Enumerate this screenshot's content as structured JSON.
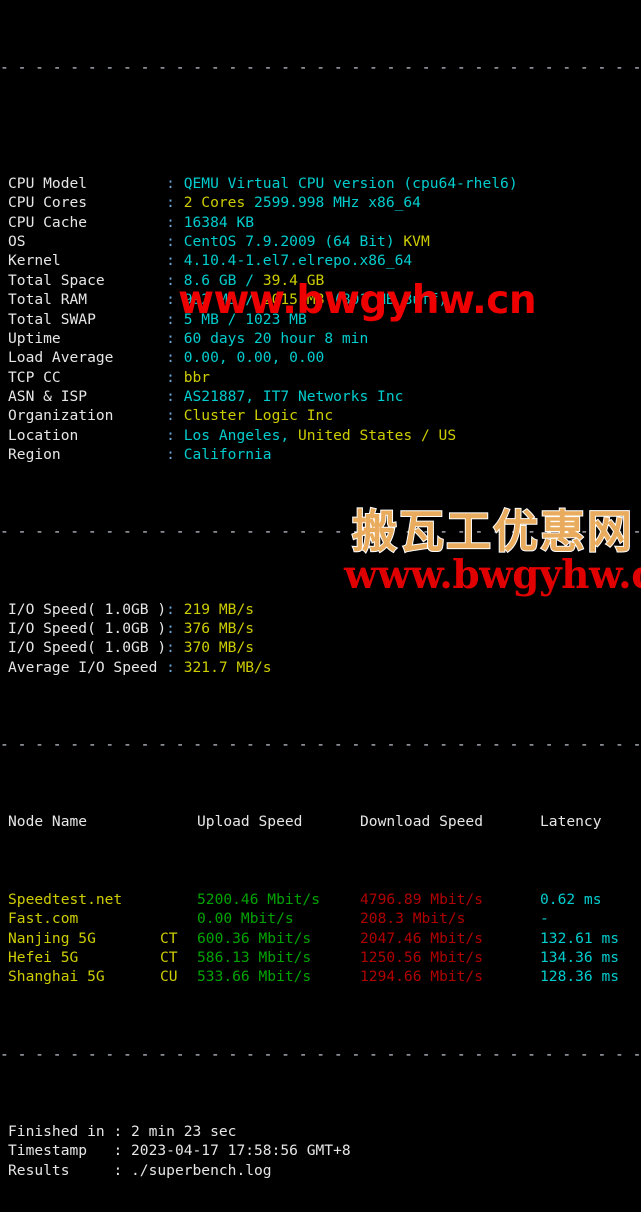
{
  "terminal": {
    "separator_top": "- - - - - - - - - - - - - - - - - - - - - - - - - - - - - - - - - - - - - - - - - -",
    "separator_mid": "- - - - - - - - - - - - - - - - - - - - - - - - - - - - - - - - - - - - - - - - - -",
    "separator_table": "- - - - - - - - - - - - - - - - - - - - - - - - - - - - - - - - - - - - - - - - - -",
    "separator_bottom": "- - - - - - - - - - - - - - - - - - - - - - - - - - - - - - - - - - - - - - - - - -",
    "colon": ":"
  },
  "sysinfo": [
    {
      "label": "CPU Model",
      "value_cyan": "QEMU Virtual CPU version (cpu64-rhel6)",
      "value_yellow": "",
      "value_tail": ""
    },
    {
      "label": "CPU Cores",
      "value_cyan": "",
      "value_yellow": "2 Cores",
      "value_tail": " 2599.998 MHz x86_64"
    },
    {
      "label": "CPU Cache",
      "value_cyan": "16384 KB",
      "value_yellow": "",
      "value_tail": ""
    },
    {
      "label": "OS",
      "value_cyan": "CentOS 7.9.2009 (64 Bit) ",
      "value_yellow": "KVM",
      "value_tail": ""
    },
    {
      "label": "Kernel",
      "value_cyan": "4.10.4-1.el7.elrepo.x86_64",
      "value_yellow": "",
      "value_tail": ""
    },
    {
      "label": "Total Space",
      "value_cyan": "8.6 GB / ",
      "value_yellow": "39.4 GB",
      "value_tail": ""
    },
    {
      "label": "Total RAM",
      "value_cyan": "992 MB / ",
      "value_yellow": "2015 MB",
      "value_tail": " (801 MB Buff)"
    },
    {
      "label": "Total SWAP",
      "value_cyan": "5 MB / 1023 MB",
      "value_yellow": "",
      "value_tail": ""
    },
    {
      "label": "Uptime",
      "value_cyan": "60 days 20 hour 8 min",
      "value_yellow": "",
      "value_tail": ""
    },
    {
      "label": "Load Average",
      "value_cyan": "0.00, 0.00, 0.00",
      "value_yellow": "",
      "value_tail": ""
    },
    {
      "label": "TCP CC",
      "value_cyan": "",
      "value_yellow": "bbr",
      "value_tail": ""
    },
    {
      "label": "ASN & ISP",
      "value_cyan": "AS21887, IT7 Networks Inc",
      "value_yellow": "",
      "value_tail": ""
    },
    {
      "label": "Organization",
      "value_cyan": "",
      "value_yellow": "Cluster Logic Inc",
      "value_tail": ""
    },
    {
      "label": "Location",
      "value_cyan": "Los Angeles, ",
      "value_yellow": "United States / US",
      "value_tail": ""
    },
    {
      "label": "Region",
      "value_cyan": "California",
      "value_yellow": "",
      "value_tail": ""
    }
  ],
  "iospeed": [
    {
      "label": "I/O Speed( 1.0GB )",
      "value": "219 MB/s"
    },
    {
      "label": "I/O Speed( 1.0GB )",
      "value": "376 MB/s"
    },
    {
      "label": "I/O Speed( 1.0GB )",
      "value": "370 MB/s"
    },
    {
      "label": "Average I/O Speed",
      "value": "321.7 MB/s"
    }
  ],
  "speedtest": {
    "headers": {
      "node": "Node Name",
      "upload": "Upload Speed",
      "download": "Download Speed",
      "latency": "Latency"
    },
    "rows": [
      {
        "node": "Speedtest.net",
        "isp": "",
        "upload": "5200.46 Mbit/s",
        "download": "4796.89 Mbit/s",
        "latency": "0.62 ms"
      },
      {
        "node": "Fast.com",
        "isp": "",
        "upload": "0.00 Mbit/s",
        "download": "208.3 Mbit/s",
        "latency": "-"
      },
      {
        "node": "Nanjing 5G",
        "isp": "CT",
        "upload": "600.36 Mbit/s",
        "download": "2047.46 Mbit/s",
        "latency": "132.61 ms"
      },
      {
        "node": "Hefei 5G",
        "isp": "CT",
        "upload": "586.13 Mbit/s",
        "download": "1250.56 Mbit/s",
        "latency": "134.36 ms"
      },
      {
        "node": "Shanghai 5G",
        "isp": "CU",
        "upload": "533.66 Mbit/s",
        "download": "1294.66 Mbit/s",
        "latency": "128.36 ms"
      }
    ]
  },
  "summary": [
    {
      "label": "Finished in",
      "value": "2 min 23 sec"
    },
    {
      "label": "Timestamp",
      "value": "2023-04-17 17:58:56 GMT+8"
    },
    {
      "label": "Results",
      "value": "./superbench.log"
    }
  ],
  "watermarks": {
    "middle_url": "www.bwgyhw.cn",
    "chinese": "搬瓦工优惠网",
    "bottom_url": "www.bwgyhw.cn"
  },
  "colors": {
    "background": "#000000",
    "label": "#e6e6e6",
    "cyan": "#00cdcd",
    "yellow": "#cdcd00",
    "green": "#00a400",
    "red": "#b00000",
    "separator": "#cfd6df",
    "watermark_red": "#ee0000",
    "watermark_orange": "#e9ac5e"
  }
}
